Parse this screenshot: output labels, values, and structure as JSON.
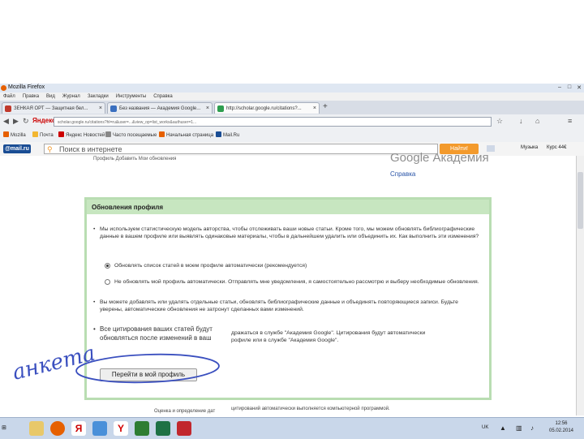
{
  "window": {
    "title": "Mozilla Firefox"
  },
  "menu": [
    "Файл",
    "Правка",
    "Вид",
    "Журнал",
    "Закладки",
    "Инструменты",
    "Справка"
  ],
  "tabs": [
    {
      "label": "ЗЕНКАЯ ОРТ — Защитная бел...",
      "fav": "#c0392b"
    },
    {
      "label": "Без названия — Академия Google...",
      "fav": "#3a6fbf"
    },
    {
      "label": "http://scholar.google.ru/citations?...",
      "fav": "#2e9e4f"
    }
  ],
  "nav": {
    "search_engine": "Яндекс",
    "url": "scholar.google.ru/citations?hl=ru&user=...&view_op=list_works&authuser=1..."
  },
  "bookmarks": [
    "Mozilla",
    "Почта",
    "Яндекс Новостей",
    "Часто посещаемые",
    "Начальная страница",
    "Mail.Ru"
  ],
  "mailbar": {
    "brand": "@mail.ru",
    "placeholder": "Поиск в интернете",
    "find": "Найти!",
    "weather": "Музыка",
    "money": "Курс 44€"
  },
  "page": {
    "gs_logo": "Google Академия",
    "help": "Справка",
    "profile_links": "Профиль     Добавить     Мои обновления"
  },
  "dialog": {
    "title": "Обновления профиля",
    "para1": "Мы используем статистическую модель авторства, чтобы отслеживать ваши новые статьи. Кроме того, мы можем обновлять библиографические данные в вашем профиле или выявлять одинаковые материалы, чтобы в дальнейшем удалить или объединить их. Как выполнить эти изменения?",
    "option1": "Обновлять список статей в моем профиле автоматически (рекомендуется)",
    "option2": "Не обновлять мой профиль автоматически. Отправлять мне уведомления, я самостоятельно рассмотрю и выберу необходимые обновления.",
    "para2": "Вы можете добавлять или удалять отдельные статьи, обновлять библиографические данные и объединять повторяющиеся записи. Будьте уверены, автоматические обновления не затронут сделанных вами изменений.",
    "para3a": "Все цитирования ваших статей будут",
    "para3b": "обновляться после изменений в ваш",
    "para3c": "дражаться в службе \"Академия Google\". Цитирования будут автоматически",
    "para3d": "рофиле или в службе \"Академия Google\".",
    "button": "Перейти в мой профиль"
  },
  "footer": {
    "left": "Оценка и определение дат",
    "right": "цитирований автоматически выполняется компьютерной программой."
  },
  "annotation": "анкета",
  "taskbar": {
    "lang": "UK",
    "time": "12:56",
    "date": "05.02.2014"
  },
  "colors": {
    "dialog_header": "#c7e6c0",
    "dialog_border": "#b9ddb2",
    "find_button": "#f39a2c",
    "annotation_ink": "#3a4fbf"
  }
}
